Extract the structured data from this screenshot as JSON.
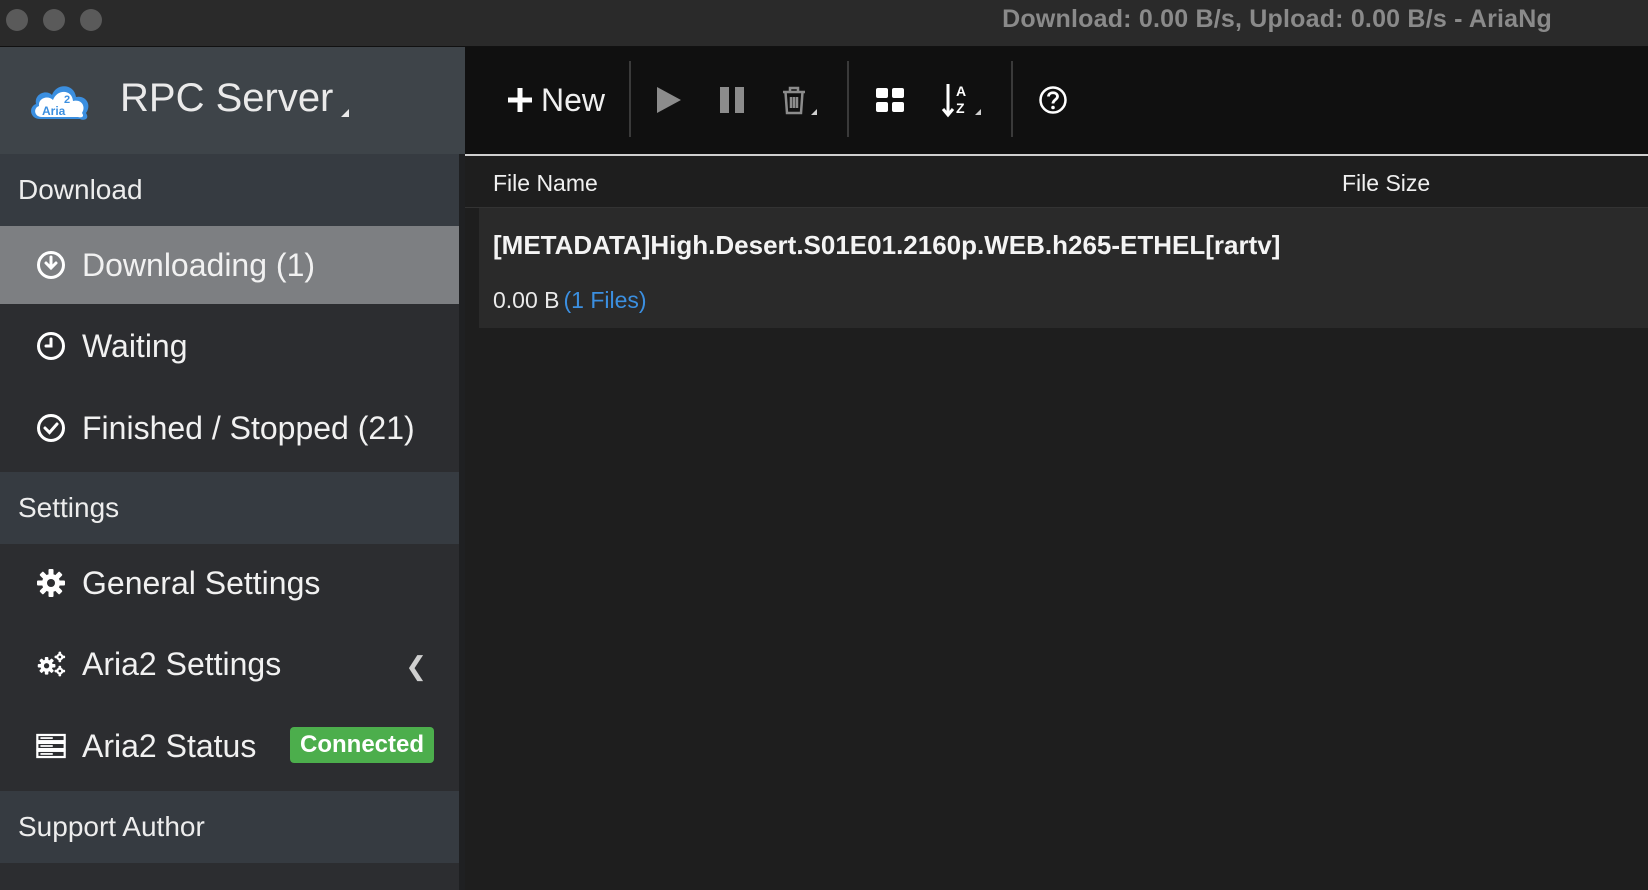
{
  "window": {
    "title": "Download: 0.00 B/s, Upload: 0.00 B/s - AriaNg"
  },
  "brand": {
    "logo_text_top": "2",
    "logo_text_bottom": "Aria",
    "name": "RPC Server"
  },
  "sidebar": {
    "sections": {
      "download": "Download",
      "settings": "Settings",
      "support": "Support Author"
    },
    "items": [
      {
        "label": "Downloading (1)",
        "icon": "download-circle-icon",
        "active": true
      },
      {
        "label": "Waiting",
        "icon": "clock-icon"
      },
      {
        "label": "Finished / Stopped (21)",
        "icon": "check-circle-icon"
      },
      {
        "label": "General Settings",
        "icon": "gear-icon"
      },
      {
        "label": "Aria2 Settings",
        "icon": "gears-icon"
      },
      {
        "label": "Aria2 Status",
        "icon": "server-icon",
        "badge": "Connected"
      }
    ]
  },
  "toolbar": {
    "new_label": "New",
    "icons": [
      "plus-icon",
      "play-icon",
      "pause-icon",
      "trash-icon",
      "grid-icon",
      "sort-az-icon",
      "help-icon"
    ]
  },
  "table": {
    "col_name": "File Name",
    "col_size": "File Size"
  },
  "tasks": [
    {
      "name": "[METADATA]High.Desert.S01E01.2160p.WEB.h265-ETHEL[rartv]",
      "size": "0.00 B",
      "files": "(1 Files)"
    }
  ],
  "colors": {
    "active_item_bg": "#7d7f82",
    "badge_bg": "#4cae4c",
    "link": "#3b8fe0",
    "logo": "#3b8fe0"
  }
}
